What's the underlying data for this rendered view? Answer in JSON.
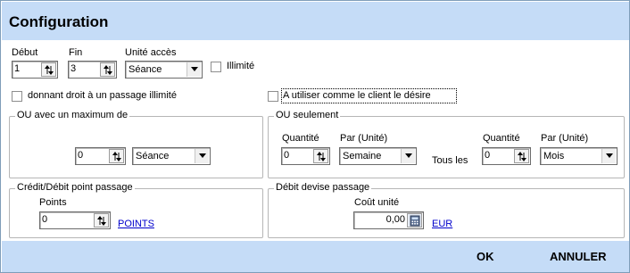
{
  "title": "Configuration",
  "top": {
    "debut": {
      "label": "Début",
      "value": "1"
    },
    "fin": {
      "label": "Fin",
      "value": "3"
    },
    "unite": {
      "label": "Unité accès",
      "value": "Séance"
    },
    "illimite_label": "Illimité",
    "illimite_checked": false
  },
  "options": {
    "donnant_label": "donnant droit à un passage illimité",
    "donnant_checked": false,
    "utiliser_label": "A utiliser comme le client le désire",
    "utiliser_checked": false
  },
  "maximum": {
    "legend": "OU avec un maximum de",
    "value": "0",
    "unit": "Séance"
  },
  "seulement": {
    "legend": "OU seulement",
    "quantite_label": "Quantité",
    "quantite_value": "0",
    "par_label": "Par (Unité)",
    "par_value": "Semaine",
    "tous_les": "Tous les",
    "quantite2_label": "Quantité",
    "quantite2_value": "0",
    "par2_label": "Par (Unité)",
    "par2_value": "Mois"
  },
  "credit": {
    "legend": "Crédit/Débit point passage",
    "points_label": "Points",
    "points_value": "0",
    "link": "POINTS"
  },
  "devise": {
    "legend": "Débit devise passage",
    "cout_label": "Coût unité",
    "cout_value": "0,00",
    "currency": "EUR"
  },
  "footer": {
    "ok": "OK",
    "cancel": "ANNULER"
  },
  "colors": {
    "header_bg": "#c5dcf7",
    "link": "#0000cc"
  }
}
